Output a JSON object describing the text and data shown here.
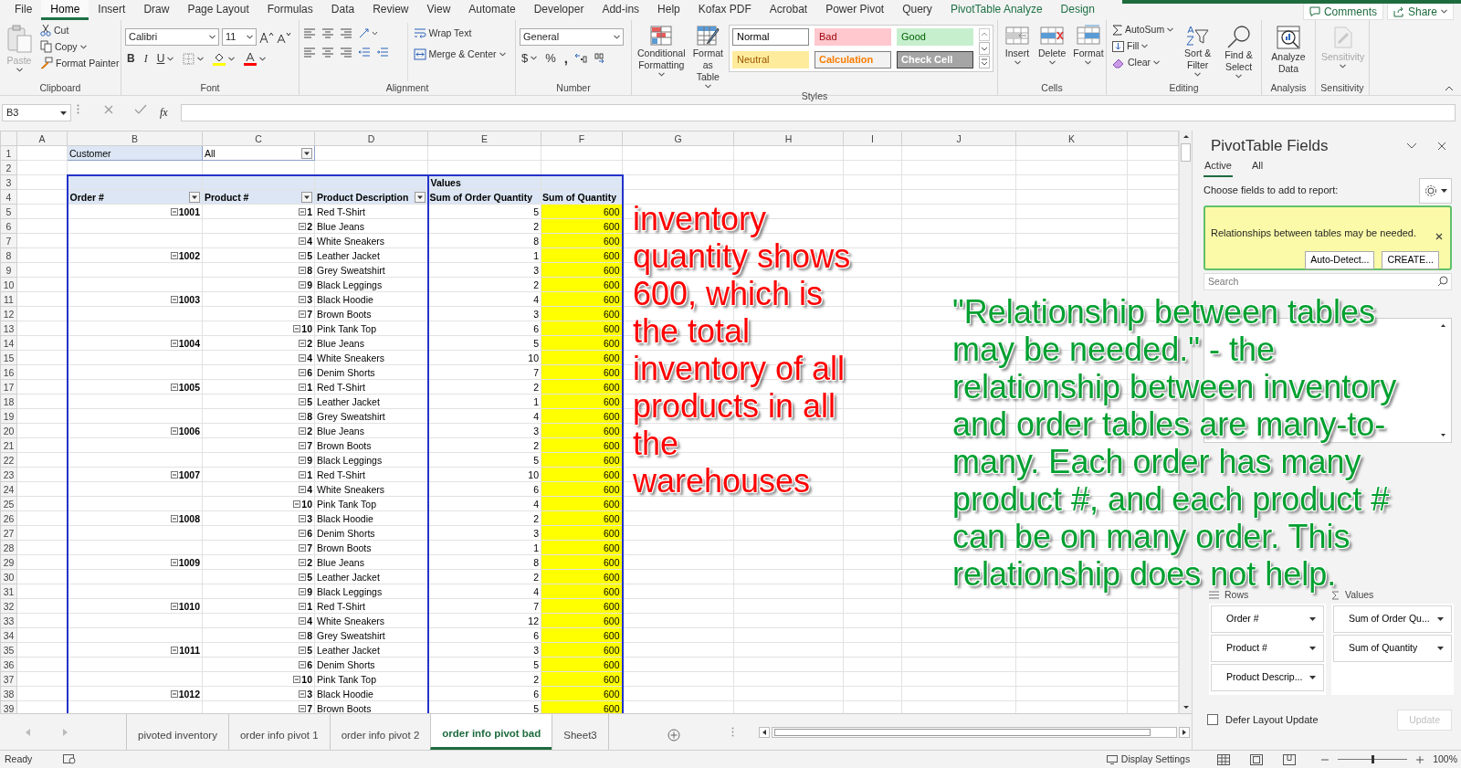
{
  "ribbon_tabs": [
    {
      "label": "File",
      "selected": false,
      "kind": "standard"
    },
    {
      "label": "Home",
      "selected": true,
      "kind": "standard"
    },
    {
      "label": "Insert",
      "selected": false,
      "kind": "standard"
    },
    {
      "label": "Draw",
      "selected": false,
      "kind": "standard"
    },
    {
      "label": "Page Layout",
      "selected": false,
      "kind": "standard"
    },
    {
      "label": "Formulas",
      "selected": false,
      "kind": "standard"
    },
    {
      "label": "Data",
      "selected": false,
      "kind": "standard"
    },
    {
      "label": "Review",
      "selected": false,
      "kind": "standard"
    },
    {
      "label": "View",
      "selected": false,
      "kind": "standard"
    },
    {
      "label": "Automate",
      "selected": false,
      "kind": "standard"
    },
    {
      "label": "Developer",
      "selected": false,
      "kind": "standard"
    },
    {
      "label": "Add-ins",
      "selected": false,
      "kind": "standard"
    },
    {
      "label": "Help",
      "selected": false,
      "kind": "standard"
    },
    {
      "label": "Kofax PDF",
      "selected": false,
      "kind": "standard"
    },
    {
      "label": "Acrobat",
      "selected": false,
      "kind": "standard"
    },
    {
      "label": "Power Pivot",
      "selected": false,
      "kind": "standard"
    },
    {
      "label": "Query",
      "selected": false,
      "kind": "standard"
    },
    {
      "label": "PivotTable Analyze",
      "selected": false,
      "kind": "contextual"
    },
    {
      "label": "Design",
      "selected": false,
      "kind": "contextual"
    }
  ],
  "header_buttons": [
    {
      "label": "Comments",
      "kind": "comments"
    },
    {
      "label": "Share",
      "kind": "share"
    }
  ],
  "ribbon": {
    "clipboard": {
      "label": "Clipboard",
      "paste": "Paste",
      "cut": "Cut",
      "copy": "Copy",
      "format_painter": "Format Painter"
    },
    "font": {
      "label": "Font",
      "name": "Calibri",
      "size": "11",
      "bold": "B",
      "italic": "I",
      "underline": "U"
    },
    "alignment": {
      "label": "Alignment",
      "wrap_text": "Wrap Text",
      "merge": "Merge & Center"
    },
    "number": {
      "label": "Number",
      "format": "General",
      "currency": "$",
      "percent": "%",
      "comma": ","
    },
    "styles": {
      "label": "Styles",
      "conditional": "Conditional Formatting",
      "format_table": "Format as Table",
      "cells": [
        {
          "label": "Normal",
          "kind": "normal"
        },
        {
          "label": "Bad",
          "kind": "bad"
        },
        {
          "label": "Good",
          "kind": "good"
        },
        {
          "label": "Neutral",
          "kind": "neutral"
        },
        {
          "label": "Calculation",
          "kind": "calculation"
        },
        {
          "label": "Check Cell",
          "kind": "check"
        }
      ]
    },
    "cells": {
      "label": "Cells",
      "insert": "Insert",
      "delete": "Delete",
      "format": "Format"
    },
    "editing": {
      "label": "Editing",
      "autosum": "AutoSum",
      "fill": "Fill",
      "clear": "Clear",
      "sort_filter": "Sort & Filter",
      "find_select": "Find & Select"
    },
    "analysis": {
      "label": "Analysis",
      "analyze_data": "Analyze Data"
    },
    "sensitivity": {
      "label": "Sensitivity",
      "button": "Sensitivity",
      "disabled": true
    }
  },
  "formula_bar": {
    "name_box": "B3",
    "fx": "fx"
  },
  "sheet": {
    "columns": [
      "A",
      "B",
      "C",
      "D",
      "E",
      "F",
      "G",
      "H",
      "I",
      "J",
      "K"
    ],
    "rows": [
      "1",
      "2",
      "3",
      "4",
      "5",
      "6",
      "7",
      "8",
      "9",
      "10",
      "11",
      "12",
      "13",
      "14",
      "15",
      "16",
      "17",
      "18",
      "19",
      "20",
      "21",
      "22",
      "23",
      "24",
      "25",
      "26",
      "27",
      "28",
      "29",
      "30",
      "31",
      "32",
      "33",
      "34",
      "35",
      "36",
      "37",
      "38",
      "39"
    ],
    "filter": {
      "field": "Customer",
      "value": "All"
    },
    "values_header": "Values",
    "headers": [
      "Order #",
      "Product #",
      "Product Description",
      "Sum of Order Quantity",
      "Sum of Quantity"
    ],
    "highlight_quantity": true,
    "orders": [
      {
        "order": "1001",
        "items": [
          [
            "1",
            "Red T-Shirt",
            "5",
            "600"
          ],
          [
            "2",
            "Blue Jeans",
            "2",
            "600"
          ],
          [
            "4",
            "White Sneakers",
            "8",
            "600"
          ]
        ]
      },
      {
        "order": "1002",
        "items": [
          [
            "5",
            "Leather Jacket",
            "1",
            "600"
          ],
          [
            "8",
            "Grey Sweatshirt",
            "3",
            "600"
          ],
          [
            "9",
            "Black Leggings",
            "2",
            "600"
          ]
        ]
      },
      {
        "order": "1003",
        "items": [
          [
            "3",
            "Black Hoodie",
            "4",
            "600"
          ],
          [
            "7",
            "Brown Boots",
            "3",
            "600"
          ],
          [
            "10",
            "Pink Tank Top",
            "6",
            "600"
          ]
        ]
      },
      {
        "order": "1004",
        "items": [
          [
            "2",
            "Blue Jeans",
            "5",
            "600"
          ],
          [
            "4",
            "White Sneakers",
            "10",
            "600"
          ],
          [
            "6",
            "Denim Shorts",
            "7",
            "600"
          ]
        ]
      },
      {
        "order": "1005",
        "items": [
          [
            "1",
            "Red T-Shirt",
            "2",
            "600"
          ],
          [
            "5",
            "Leather Jacket",
            "1",
            "600"
          ],
          [
            "8",
            "Grey Sweatshirt",
            "4",
            "600"
          ]
        ]
      },
      {
        "order": "1006",
        "items": [
          [
            "2",
            "Blue Jeans",
            "3",
            "600"
          ],
          [
            "7",
            "Brown Boots",
            "2",
            "600"
          ],
          [
            "9",
            "Black Leggings",
            "5",
            "600"
          ]
        ]
      },
      {
        "order": "1007",
        "items": [
          [
            "1",
            "Red T-Shirt",
            "10",
            "600"
          ],
          [
            "4",
            "White Sneakers",
            "6",
            "600"
          ],
          [
            "10",
            "Pink Tank Top",
            "4",
            "600"
          ]
        ]
      },
      {
        "order": "1008",
        "items": [
          [
            "3",
            "Black Hoodie",
            "2",
            "600"
          ],
          [
            "6",
            "Denim Shorts",
            "3",
            "600"
          ],
          [
            "7",
            "Brown Boots",
            "1",
            "600"
          ]
        ]
      },
      {
        "order": "1009",
        "items": [
          [
            "2",
            "Blue Jeans",
            "8",
            "600"
          ],
          [
            "5",
            "Leather Jacket",
            "2",
            "600"
          ],
          [
            "9",
            "Black Leggings",
            "4",
            "600"
          ]
        ]
      },
      {
        "order": "1010",
        "items": [
          [
            "1",
            "Red T-Shirt",
            "7",
            "600"
          ],
          [
            "4",
            "White Sneakers",
            "12",
            "600"
          ],
          [
            "8",
            "Grey Sweatshirt",
            "6",
            "600"
          ]
        ]
      },
      {
        "order": "1011",
        "items": [
          [
            "5",
            "Leather Jacket",
            "3",
            "600"
          ],
          [
            "6",
            "Denim Shorts",
            "5",
            "600"
          ],
          [
            "10",
            "Pink Tank Top",
            "2",
            "600"
          ]
        ]
      },
      {
        "order": "1012",
        "items": [
          [
            "3",
            "Black Hoodie",
            "6",
            "600"
          ],
          [
            "7",
            "Brown Boots",
            "5",
            "600"
          ]
        ]
      }
    ]
  },
  "annotations": [
    {
      "color": "#ff0000",
      "lines": [
        "inventory",
        "quantity shows",
        "600, which is",
        "the total",
        "inventory of all",
        "products in all",
        "the",
        "warehouses"
      ]
    },
    {
      "color": "#00a030",
      "lines": [
        "\"Relationship between tables",
        "may be needed.\" - the",
        "relationship between inventory",
        "and order tables are many-to-",
        "many.  Each order has many",
        "product #, and each product #",
        "can be on many order.  This",
        "relationship does not help."
      ]
    }
  ],
  "sheet_tabs": [
    {
      "label": "pivoted inventory",
      "selected": false
    },
    {
      "label": "order info pivot 1",
      "selected": false
    },
    {
      "label": "order info pivot 2",
      "selected": false
    },
    {
      "label": "order info pivot bad",
      "selected": true
    },
    {
      "label": "Sheet3",
      "selected": false
    }
  ],
  "status_bar": {
    "status": "Ready",
    "display_settings": "Display Settings",
    "zoom": "100%",
    "zoom_slider": {
      "level": 0.5
    }
  },
  "pivot_panel": {
    "title": "PivotTable Fields",
    "tabs": [
      {
        "label": "Active",
        "selected": true
      },
      {
        "label": "All",
        "selected": false
      }
    ],
    "prompt": "Choose fields to add to report:",
    "notice": {
      "text": "Relationships between tables may be needed.",
      "buttons": [
        "Auto-Detect...",
        "CREATE..."
      ]
    },
    "search": {
      "placeholder": "Search"
    },
    "areas": [
      {
        "kind": "rows",
        "title": "Rows",
        "items": [
          "Order #",
          "Product #",
          "Product Descrip..."
        ]
      },
      {
        "kind": "values",
        "title": "Values",
        "items": [
          "Sum of Order Qu...",
          "Sum of Quantity"
        ]
      }
    ],
    "defer": {
      "label": "Defer Layout Update",
      "checked": false
    },
    "update": {
      "label": "Update",
      "disabled": true
    }
  }
}
